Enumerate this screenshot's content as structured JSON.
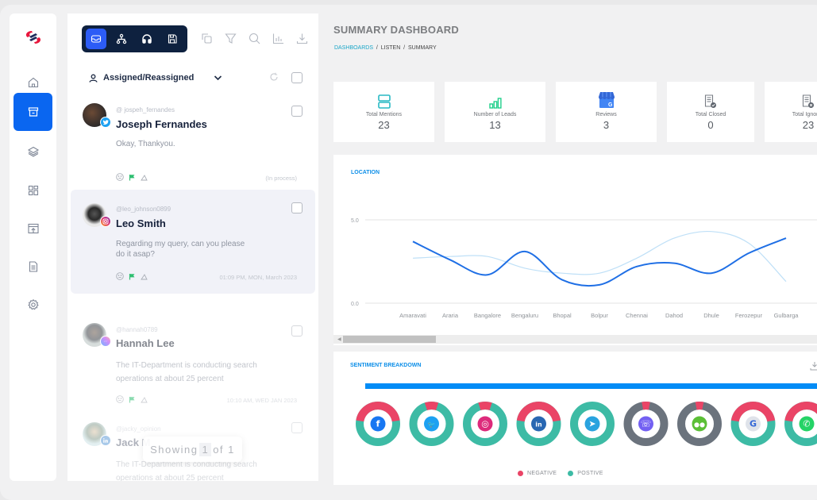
{
  "sidebar": {
    "items": [
      {
        "name": "home",
        "icon": "home-icon",
        "active": false
      },
      {
        "name": "inbox",
        "icon": "archive-box-icon",
        "active": true
      },
      {
        "name": "layers",
        "icon": "layers-icon",
        "active": false
      },
      {
        "name": "dashboard",
        "icon": "grid-icon",
        "active": false
      },
      {
        "name": "publish",
        "icon": "upload-tray-icon",
        "active": false
      },
      {
        "name": "reports",
        "icon": "document-icon",
        "active": false
      },
      {
        "name": "settings",
        "icon": "gear-icon",
        "active": false
      }
    ]
  },
  "inbox": {
    "toolbar": [
      "inbox-icon",
      "hierarchy-icon",
      "headphones-icon",
      "save-icon"
    ],
    "tools": [
      "copy-icon",
      "filter-icon",
      "search-icon",
      "bar-chart-icon",
      "download-icon"
    ],
    "filter_label": "Assigned/Reassigned",
    "messages": [
      {
        "handle": "@ jospeh_fernandes",
        "name": "Joseph Fernandes",
        "text": "Okay, Thankyou.",
        "status": "(In process)",
        "platform": "twitter"
      },
      {
        "handle": "@leo_johnson0899",
        "name": "Leo Smith",
        "text": "Regarding my query, can you please do it asap?",
        "status": "01:09 PM, MON, March 2023",
        "platform": "instagram"
      },
      {
        "handle": "@hannah0789",
        "name": "Hannah Lee",
        "text": "The IT-Department is conducting search operations at about 25 percent",
        "status": "10:10 AM, WED JAN 2023",
        "platform": "messenger"
      },
      {
        "handle": "@jacky_opinion",
        "name": "Jack M",
        "text": "The IT-Department is conducting search operations at about 25 percent",
        "status": "",
        "platform": "linkedin"
      }
    ],
    "pagination": {
      "prefix": "Showing",
      "current": "1",
      "of": "of 1"
    }
  },
  "main": {
    "title": "SUMMARY DASHBOARD",
    "breadcrumb": [
      "DASHBOARDS",
      "LISTEN",
      "SUMMARY"
    ],
    "kpis": [
      {
        "label": "Total Mentions",
        "value": "23",
        "icon": "mentions-icon"
      },
      {
        "label": "Number of Leads",
        "value": "13",
        "icon": "leads-bars-icon"
      },
      {
        "label": "Reviews",
        "value": "3",
        "icon": "google-business-icon"
      },
      {
        "label": "Total Closed",
        "value": "0",
        "icon": "document-check-icon"
      },
      {
        "label": "Total Ignored",
        "value": "23",
        "icon": "document-x-icon"
      }
    ],
    "location_title": "LOCATION",
    "sentiment_title": "SENTIMENT BREAKDOWN"
  },
  "chart_data": [
    {
      "type": "line",
      "title": "LOCATION",
      "categories": [
        "Amaravati",
        "Araria",
        "Bangalore",
        "Bengaluru",
        "Bhopal",
        "Bolpur",
        "Chennai",
        "Dahod",
        "Dhule",
        "Ferozepur",
        "Gulbarga"
      ],
      "ylim": [
        0,
        5
      ],
      "yticks": [
        "0.0",
        "5.0"
      ],
      "grid": true,
      "series": [
        {
          "name": "primary",
          "color": "#1f6fe5",
          "values": [
            3.7,
            2.6,
            1.7,
            3.1,
            1.4,
            1.1,
            2.2,
            2.4,
            1.8,
            3.0,
            3.9
          ]
        },
        {
          "name": "secondary",
          "color": "#bfe0f7",
          "values": [
            2.7,
            2.8,
            2.8,
            2.1,
            1.8,
            1.8,
            2.7,
            3.9,
            4.3,
            3.6,
            1.3
          ]
        }
      ]
    },
    {
      "type": "pie",
      "title": "SENTIMENT BREAKDOWN",
      "legend": [
        {
          "label": "NEGATIVE",
          "color": "#ea4466"
        },
        {
          "label": "POSTIVE",
          "color": "#3dbba5"
        }
      ],
      "neutral_color": "#6b737d",
      "series": [
        {
          "platform": "facebook",
          "negative": 0.45,
          "positive": 0.55,
          "neutral": 0
        },
        {
          "platform": "twitter",
          "negative": 0.1,
          "positive": 0.9,
          "neutral": 0
        },
        {
          "platform": "instagram",
          "negative": 0.1,
          "positive": 0.9,
          "neutral": 0
        },
        {
          "platform": "linkedin",
          "negative": 0.45,
          "positive": 0.55,
          "neutral": 0
        },
        {
          "platform": "telegram",
          "negative": 0,
          "positive": 1,
          "neutral": 0
        },
        {
          "platform": "viber",
          "negative": 0.06,
          "positive": 0,
          "neutral": 0.94
        },
        {
          "platform": "wechat",
          "negative": 0.06,
          "positive": 0,
          "neutral": 0.94
        },
        {
          "platform": "google-business",
          "negative": 0.45,
          "positive": 0.55,
          "neutral": 0
        },
        {
          "platform": "whatsapp",
          "negative": 0.45,
          "positive": 0.55,
          "neutral": 0
        }
      ]
    }
  ]
}
